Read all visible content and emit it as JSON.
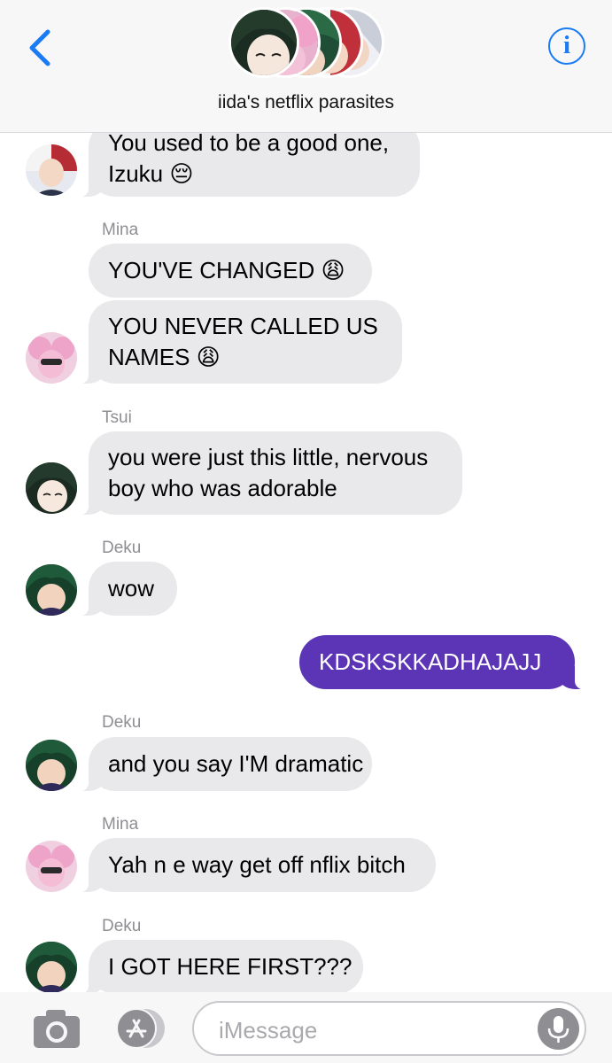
{
  "header": {
    "group_name": "iida's netflix parasites",
    "info_glyph": "i",
    "accent": "#1a7cf5"
  },
  "messages": [
    {
      "sender": "",
      "lines": "You used to be a good one,\nIzuku 😔",
      "avatar": "todoroki"
    },
    {
      "sender": "Mina",
      "lines": "YOU'VE CHANGED 😩"
    },
    {
      "lines": "YOU NEVER CALLED US\nNAMES 😩",
      "avatar": "mina"
    },
    {
      "sender": "Tsui",
      "lines": "you were just this little, nervous\nboy who was adorable",
      "avatar": "tsui"
    },
    {
      "sender": "Deku",
      "lines": "wow",
      "avatar": "deku"
    },
    {
      "lines": "KDSKSKKADHAJAJJ",
      "outgoing": true,
      "color": "#5b35b5"
    },
    {
      "sender": "Deku",
      "lines": "and you say I'M dramatic",
      "avatar": "deku"
    },
    {
      "sender": "Mina",
      "lines": "Yah n e way get off nflix bitch",
      "avatar": "mina"
    },
    {
      "sender": "Deku",
      "lines": "I GOT HERE FIRST???",
      "avatar": "deku"
    }
  ],
  "input": {
    "placeholder": "iMessage"
  },
  "icons": [
    "back-chevron-icon",
    "info-icon",
    "camera-icon",
    "app-store-icon",
    "microphone-icon"
  ]
}
